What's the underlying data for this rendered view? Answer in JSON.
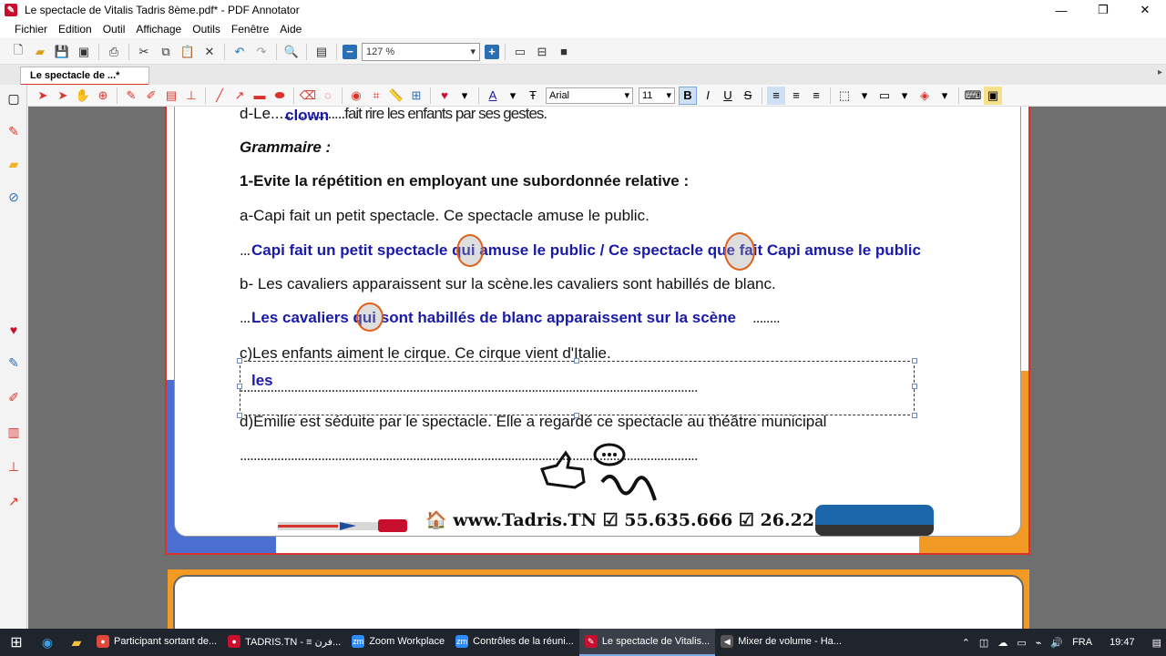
{
  "window": {
    "title": "Le spectacle de Vitalis Tadris 8ème.pdf* - PDF Annotator",
    "controls": [
      "—",
      "❐",
      "✕"
    ]
  },
  "menu": [
    "Fichier",
    "Edition",
    "Outil",
    "Affichage",
    "Outils",
    "Fenêtre",
    "Aide"
  ],
  "toolbar": {
    "zoom_value": "127 %"
  },
  "tab": {
    "label": "Le spectacle de ...*"
  },
  "format": {
    "font": "Arial",
    "size": "11"
  },
  "document": {
    "line_d": "d-Le...",
    "line_d_dots": "..................fait rire les enfants par ses gestes.",
    "answer_clown": "clown",
    "grammar_title": "Grammaire :",
    "exercise_title": "1-Evite la répétition en employant une subordonnée relative :",
    "q_a": "a-Capi fait un petit spectacle. Ce spectacle amuse le public.",
    "ans_a": "Capi fait un petit spectacle qui amuse le public / Ce spectacle que fait Capi amuse le public",
    "q_b": "b- Les cavaliers apparaissent sur la scène.les cavaliers sont habillés de blanc.",
    "ans_b": "Les cavaliers qui sont habillés de blanc apparaissent sur la scène",
    "q_c": "c)Les enfants aiment le cirque. Ce cirque vient d'Italie.",
    "ans_c": "les",
    "q_d": "d)Emilie est séduite par le spectacle. Elle a regardé ce spectacle au théâtre municipal",
    "dots_prefix": "...",
    "dots_tail": "........",
    "dots_long": ".......................................................................................................................................",
    "footer": "🏠 www.Tadris.TN  ☑ 55.635.666  ☑ 26.222.159"
  },
  "taskbar": {
    "apps": [
      {
        "label": "Participant sortant de...",
        "color": "#e0483a"
      },
      {
        "label": "TADRIS.TN - ≡ فرن...",
        "color": "#c8102e"
      },
      {
        "label": "Zoom Workplace",
        "color": "#2d8cff"
      },
      {
        "label": "Contrôles de la réuni...",
        "color": "#2d8cff"
      },
      {
        "label": "Le spectacle de Vitalis...",
        "color": "#c8102e"
      },
      {
        "label": "Mixer de volume - Ha...",
        "color": "#555"
      }
    ],
    "lang": "FRA",
    "time": "19:47"
  }
}
